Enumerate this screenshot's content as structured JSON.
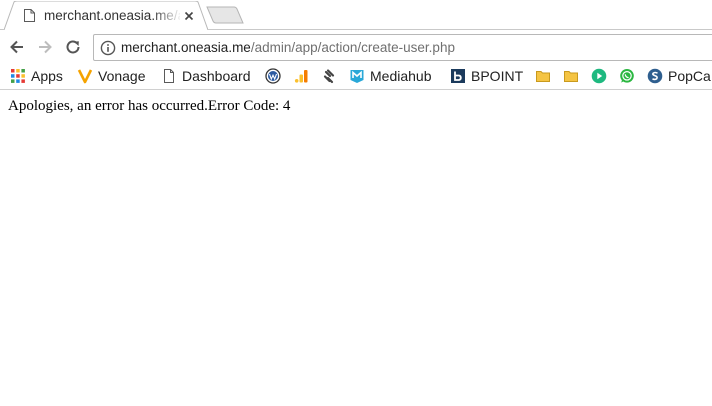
{
  "tab": {
    "title": "merchant.oneasia.me/admin/app/action/create-user.php",
    "favicon": "page-icon",
    "close": "close-icon"
  },
  "toolbar": {
    "back": "back-arrow-icon",
    "forward": "forward-arrow-icon",
    "reload": "reload-icon",
    "site_info": "info-icon",
    "url_host": "merchant.oneasia.me",
    "url_path": "/admin/app/action/create-user.php"
  },
  "bookmarks": [
    {
      "label": "Apps",
      "icon": "apps-grid-icon"
    },
    {
      "label": "Vonage",
      "icon": "vonage-icon"
    },
    {
      "label": "Dashboard",
      "icon": "page-icon"
    },
    {
      "label": "",
      "icon": "wordpress-icon"
    },
    {
      "label": "",
      "icon": "analytics-icon"
    },
    {
      "label": "",
      "icon": "squarespace-icon"
    },
    {
      "label": "Mediahub",
      "icon": "mediahub-icon"
    },
    {
      "label": "BPOINT",
      "icon": "bpoint-icon"
    },
    {
      "label": "",
      "icon": "folder-icon"
    },
    {
      "label": "",
      "icon": "folder-icon"
    },
    {
      "label": "",
      "icon": "play-icon"
    },
    {
      "label": "",
      "icon": "whatsapp-icon"
    },
    {
      "label": "PopCa",
      "icon": "popcash-icon"
    }
  ],
  "page": {
    "error_message": "Apologies, an error has occurred.Error Code: 4"
  },
  "colors": {
    "tab_border": "#c9c9c9",
    "url_path": "#707070",
    "folder": "#f5c443",
    "play_green": "#1db954",
    "whatsapp_green": "#2bb741",
    "analytics_orange": "#f5a300"
  }
}
